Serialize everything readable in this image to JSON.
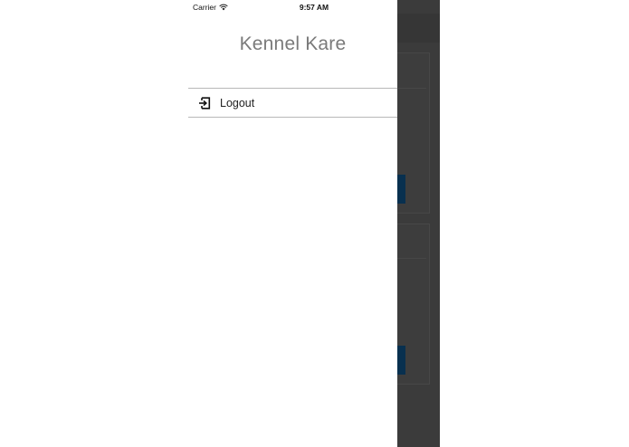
{
  "status_bar": {
    "carrier": "Carrier",
    "time": "9:57 AM",
    "battery_color": "#4cd964"
  },
  "drawer": {
    "title": "Kennel Kare",
    "menu_items": [
      {
        "label": "Logout",
        "icon": "logout-icon"
      }
    ]
  },
  "colors": {
    "title_text": "#7a7a7a",
    "overlay": "#3b3b3b",
    "card_button": "#08304f"
  }
}
